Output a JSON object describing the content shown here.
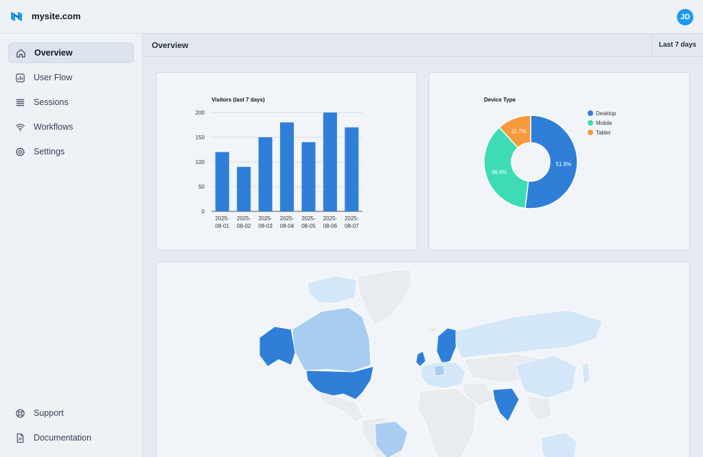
{
  "app": {
    "site_name": "mysite.com",
    "user_initials": "JD"
  },
  "sidebar": {
    "items": [
      {
        "label": "Overview",
        "icon": "home-icon",
        "active": true
      },
      {
        "label": "User Flow",
        "icon": "chart-icon",
        "active": false
      },
      {
        "label": "Sessions",
        "icon": "list-icon",
        "active": false
      },
      {
        "label": "Workflows",
        "icon": "wifi-icon",
        "active": false
      },
      {
        "label": "Settings",
        "icon": "gear-icon",
        "active": false
      }
    ],
    "footer_items": [
      {
        "label": "Support",
        "icon": "lifebuoy-icon"
      },
      {
        "label": "Documentation",
        "icon": "document-icon"
      }
    ]
  },
  "header": {
    "title": "Overview",
    "range_label": "Last 7 days"
  },
  "colors": {
    "accent": "#1d9bf0",
    "bar": "#2f7fd8",
    "desktop": "#2f7fd8",
    "mobile": "#3ddcb4",
    "tablet": "#f59a3c",
    "map_high": "#2f7fd8",
    "map_mid": "#a8cdf0",
    "map_low": "#d4e7f8",
    "map_none": "#e9ecef"
  },
  "chart_data": [
    {
      "type": "bar",
      "title": "Visitors (last 7 days)",
      "categories": [
        "2025-08-01",
        "2025-08-02",
        "2025-08-03",
        "2025-08-04",
        "2025-08-05",
        "2025-08-06",
        "2025-08-07"
      ],
      "values": [
        120,
        90,
        150,
        180,
        140,
        200,
        170
      ],
      "ylim": [
        0,
        200
      ],
      "yticks": [
        0,
        50,
        100,
        150,
        200
      ],
      "grid": true
    },
    {
      "type": "pie",
      "title": "Device Type",
      "donut": true,
      "legend_position": "right",
      "series": [
        {
          "name": "Desktop",
          "value": 51.9,
          "label": "51.9%"
        },
        {
          "name": "Mobile",
          "value": 36.4,
          "label": "36.4%"
        },
        {
          "name": "Tablet",
          "value": 11.7,
          "label": "11.7%"
        }
      ]
    }
  ]
}
